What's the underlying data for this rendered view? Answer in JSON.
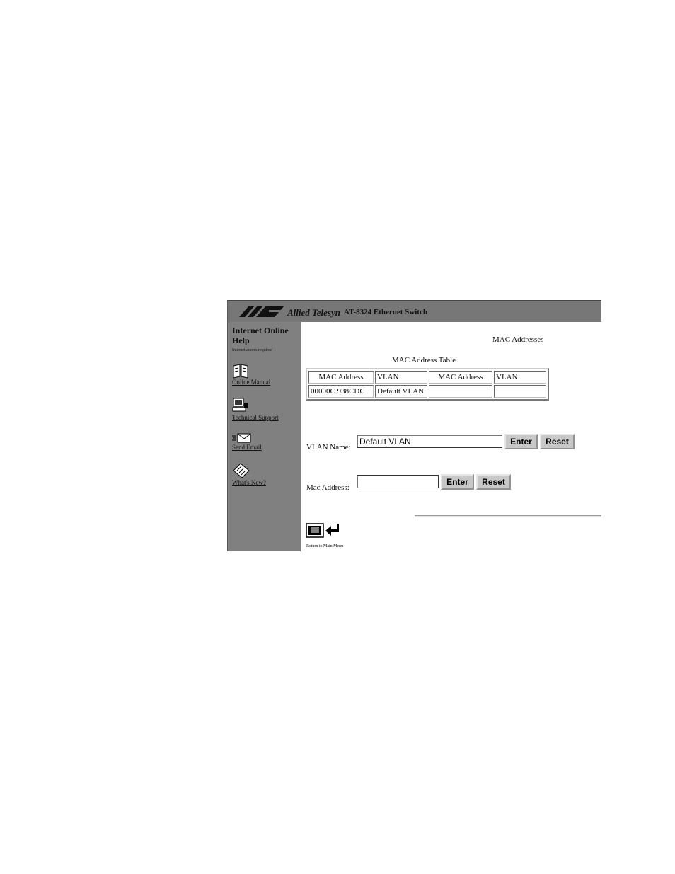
{
  "header": {
    "brand": "Allied Telesyn",
    "product": "AT-8324 Ethernet Switch"
  },
  "sidebar": {
    "title": "Internet Online Help",
    "note": "Internet access required",
    "items": [
      {
        "label": "Online Manual",
        "icon": "book-icon"
      },
      {
        "label": "Technical Support",
        "icon": "computer-phone-icon"
      },
      {
        "label": "Send Email",
        "icon": "envelope-icon"
      },
      {
        "label": "What's New?",
        "icon": "newspaper-icon"
      }
    ]
  },
  "main": {
    "title": "MAC Addresses",
    "table": {
      "caption": "MAC Address Table",
      "headers": [
        "MAC Address",
        "VLAN",
        "MAC Address",
        "VLAN"
      ],
      "rows": [
        [
          "00000C 938CDC",
          "Default VLAN",
          "",
          ""
        ]
      ]
    },
    "vlan_form": {
      "label": "VLAN Name:",
      "value": "Default VLAN",
      "enter": "Enter",
      "reset": "Reset"
    },
    "mac_form": {
      "label": "Mac Address:",
      "value": "",
      "enter": "Enter",
      "reset": "Reset"
    },
    "return_label": "Return to Main Menu",
    "return_icon": "return-menu-icon"
  }
}
